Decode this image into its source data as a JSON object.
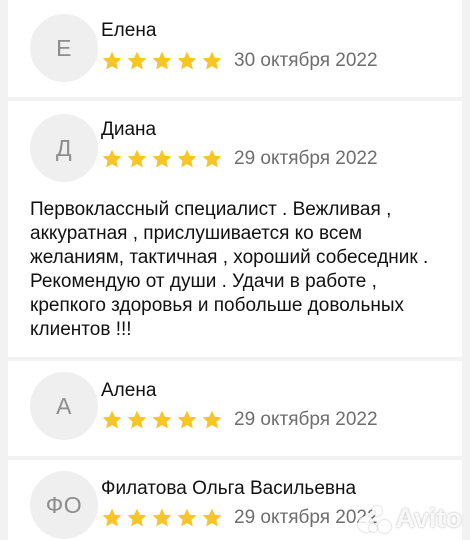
{
  "reviews": [
    {
      "avatar_letter": "Е",
      "author": "Елена",
      "date": "30 октября 2022",
      "rating": 5,
      "text": ""
    },
    {
      "avatar_letter": "Д",
      "author": "Диана",
      "date": "29 октября 2022",
      "rating": 5,
      "text": "Первоклассный специалист . Вежливая , аккуратная , прислушивается ко всем желаниям, тактичная , хороший собеседник . Рекомендую от души . Удачи в работе , крепкого здоровья и побольше довольных клиентов !!!"
    },
    {
      "avatar_letter": "А",
      "author": "Алена",
      "date": "29 октября 2022",
      "rating": 5,
      "text": ""
    },
    {
      "avatar_letter": "ФО",
      "author": "Филатова Ольга Васильевна",
      "date": "29 октября 2022",
      "rating": 5,
      "text": ""
    }
  ],
  "watermark": "Avito",
  "colors": {
    "star": "#f7c525",
    "avatar_bg": "#efefef",
    "avatar_text": "#8d8d8d",
    "date": "#6e6e6e",
    "page_bg": "#f2f2f2"
  },
  "icons": {
    "star": "star-icon"
  }
}
